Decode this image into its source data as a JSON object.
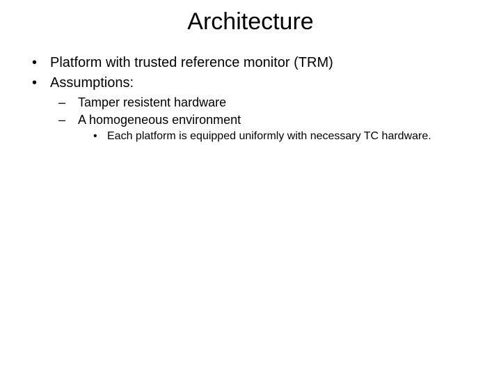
{
  "title": "Architecture",
  "bullets": {
    "item1": "Platform with trusted reference monitor (TRM)",
    "item2": "Assumptions:",
    "item2_sub1": "Tamper resistent hardware",
    "item2_sub2": "A homogeneous environment",
    "item2_sub2_sub1": "Each platform is equipped uniformly with necessary TC hardware."
  },
  "markers": {
    "l1": "•",
    "l2": "–",
    "l3": "•"
  }
}
